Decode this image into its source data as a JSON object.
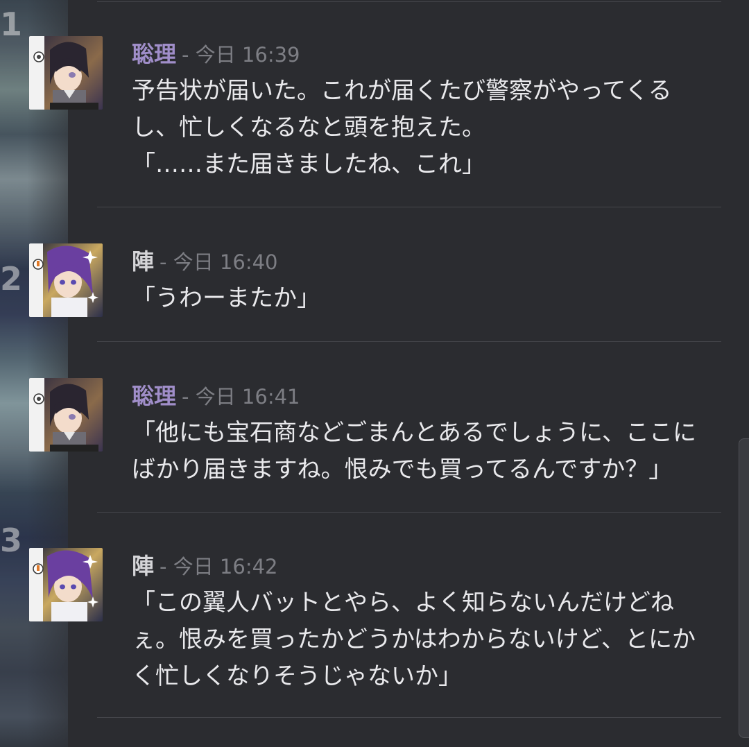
{
  "messages": [
    {
      "author": "聡理",
      "timestamp": "- 今日 16:39",
      "text": "予告状が届いた。これが届くたび警察がやってくる\nし、忙しくなるなと頭を抱えた。\n「……また届きましたね、これ」",
      "accent": "#a08ec9",
      "avatar_icon": "character-avatar-satori"
    },
    {
      "author": "陣",
      "timestamp": "- 今日 16:40",
      "text": "「うわーまたか」",
      "accent": "#d5d5d8",
      "avatar_icon": "character-avatar-jin"
    },
    {
      "author": "聡理",
      "timestamp": "- 今日 16:41",
      "text": "「他にも宝石商などごまんとあるでしょうに、ここに\nばかり届きますね。恨みでも買ってるんですか？」",
      "accent": "#a08ec9",
      "avatar_icon": "character-avatar-satori"
    },
    {
      "author": "陣",
      "timestamp": "- 今日 16:42",
      "text": "「この翼人バットとやら、よく知らないんだけどね\nぇ。恨みを買ったかどうかはわからないけど、とにか\nく忙しくなりそうじゃないか」",
      "accent": "#d5d5d8",
      "avatar_icon": "character-avatar-jin"
    }
  ],
  "background": {
    "glyphs": [
      "1",
      "2",
      "3"
    ]
  }
}
